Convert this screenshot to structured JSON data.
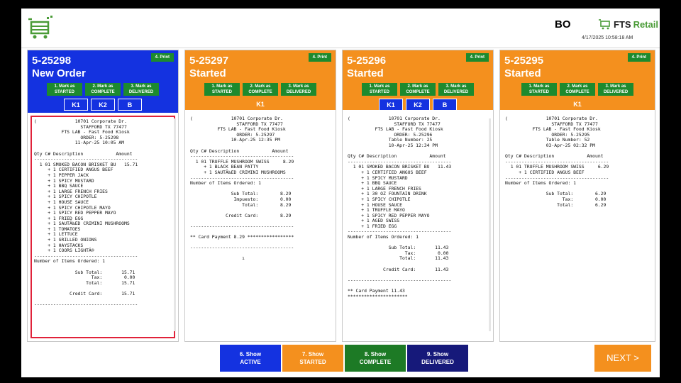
{
  "header": {
    "user_code": "BO",
    "brand_prefix": "FTS",
    "brand_suffix": "Retail",
    "timestamp": "4/17/2025 10:58:18 AM"
  },
  "colors": {
    "blue": "#1432e0",
    "orange": "#f4901e",
    "green": "#1d8a2e",
    "navy": "#16197a",
    "select_red": "#e0223a"
  },
  "columns": [
    {
      "order_no": "5-25298",
      "status": "New Order",
      "print_label": "4. Print",
      "mark_buttons": [
        [
          "1. Mark as",
          "STARTED"
        ],
        [
          "2. Mark as",
          "COMPLETE"
        ],
        [
          "3. Mark as",
          "DELIVERED"
        ]
      ],
      "kitchen": [
        "K1",
        "K2",
        "B"
      ],
      "receipt": "(              10701 Corporate Dr.\n                 STAFFORD TX 77477\n          FTS LAB - Fast Food Kiosk\n                 ORDER: 5-25298\n               11-Apr-25 10:05 AM\n\nQty C# Description            Amount\n--------------------------------------\n  1 01 SMOKED BACON BRISKET BU   15.71\n     + 1 CERTIFIED ANGUS BEEF\n     + 1 PEPPER JACK\n     + 1 SPICY MUSTARD\n     + 1 BBQ SAUCE\n     + 1 LARGE FRENCH FRIES\n     + 1 SPICY CHIPOTLE\n     + 1 HOUSE SAUCE\n     + 1 SPICY CHIPOTLE MAYO\n     + 1 SPICY RED PEPPER MAYO\n     + 1 FRIED EGG\n     + 1 SAUTÃ‰ED CRIMINI MUSHROOMS\n     + 1 TOMATOES\n     + 1 LETTUCE\n     + 1 GRILLED ONIONS\n     + 1 HAYSTACKS\n     + 1 COORS LIGHTÂ®\n--------------------------------------\nNumber of Items Ordered: 1\n\n               Sub Total:       15.71\n                     Tax:        0.00\n                   Total:       15.71\n\n             Credit Card:       15.71\n\n--------------------------------------"
    },
    {
      "order_no": "5-25297",
      "status": "Started",
      "print_label": "4. Print",
      "mark_buttons": [
        [
          "1. Mark as",
          "STARTED"
        ],
        [
          "2. Mark as",
          "COMPLETE"
        ],
        [
          "3. Mark as",
          "DELIVERED"
        ]
      ],
      "kitchen": [
        "K1"
      ],
      "receipt": "(              10701 Corporate Dr.\n                 STAFFORD TX 77477\n          FTS LAB - Fast Food Kiosk\n                 ORDER: 5-25297\n               10-Apr-25 12:35 PM\n\nQty C# Description            Amount\n--------------------------------------\n  1 01 TRUFFLE MUSHROOM SWISS     8.29\n     + 1 BLACK BEAN PATTY\n     + 1 SAUTÃ‰ED CRIMINI MUSHROOMS\n--------------------------------------\nNumber of Items Ordered: 1\n\n               Sub Total:        8.29\n                Impuesto:        0.00\n                   Total:        8.29\n\n             Credit Card:        8.29\n\n--------------------------------------\n\n** Card Payment 8.29 *****************\n\n--------------------------------------\n\n                   ı"
    },
    {
      "order_no": "5-25296",
      "status": "Started",
      "print_label": "4. Print",
      "mark_buttons": [
        [
          "1. Mark as",
          "STARTED"
        ],
        [
          "2. Mark as",
          "COMPLETE"
        ],
        [
          "3. Mark as",
          "DELIVERED"
        ]
      ],
      "kitchen": [
        "K1",
        "K2",
        "B"
      ],
      "receipt": "(              10701 Corporate Dr.\n                 STAFFORD TX 77477\n          FTS LAB - Fast Food Kiosk\n                 ORDER: 5-25296\n               Table Number: 25\n               10-Apr-25 12:34 PM\n\nQty C# Description            Amount\n--------------------------------------\n  1 01 SMOKED BACON BRISKET BU   11.43\n     + 1 CERTIFIED ANGUS BEEF\n     + 1 SPICY MUSTARD\n     + 1 BBQ SAUCE\n     + 1 LARGE FRENCH FRIES\n     + 1 30 OZ FOUNTAIN DRINK\n     + 1 SPICY CHIPOTLE\n     + 1 HOUSE SAUCE\n     + 1 TRUFFLE MAYO\n     + 1 SPICY RED PEPPER MAYO\n     + 1 AGED SWISS\n     + 1 FRIED EGG\n--------------------------------------\nNumber of Items Ordered: 1\n\n               Sub Total:       11.43\n                     Tax:        0.00\n                   Total:       11.43\n\n             Credit Card:       11.43\n\n--------------------------------------\n\n** Card Payment 11.43\n**********************"
    },
    {
      "order_no": "5-25295",
      "status": "Started",
      "print_label": "4. Print",
      "mark_buttons": [
        [
          "1. Mark as",
          "STARTED"
        ],
        [
          "2. Mark as",
          "COMPLETE"
        ],
        [
          "3. Mark as",
          "DELIVERED"
        ]
      ],
      "kitchen": [
        "K1"
      ],
      "receipt": "(              10701 Corporate Dr.\n                 STAFFORD TX 77477\n          FTS LAB - Fast Food Kiosk\n                 ORDER: 5-25295\n               Table Number: 52\n               03-Apr-25 02:32 PM\n\nQty C# Description            Amount\n--------------------------------------\n  1 01 TRUFFLE MUSHROOM SWISS     6.29\n     + 1 CERTIFIED ANGUS BEEF\n--------------------------------------\nNumber of Items Ordered: 1\n\n               Sub Total:        6.29\n                     Tax:        0.00\n                   Total:        6.29"
    }
  ],
  "footer": {
    "buttons": [
      {
        "line1": "6. Show",
        "line2": "ACTIVE"
      },
      {
        "line1": "7. Show",
        "line2": "STARTED"
      },
      {
        "line1": "8. Show",
        "line2": "COMPLETE"
      },
      {
        "line1": "9. Show",
        "line2": "DELIVERED"
      }
    ],
    "next_label": "NEXT >"
  }
}
